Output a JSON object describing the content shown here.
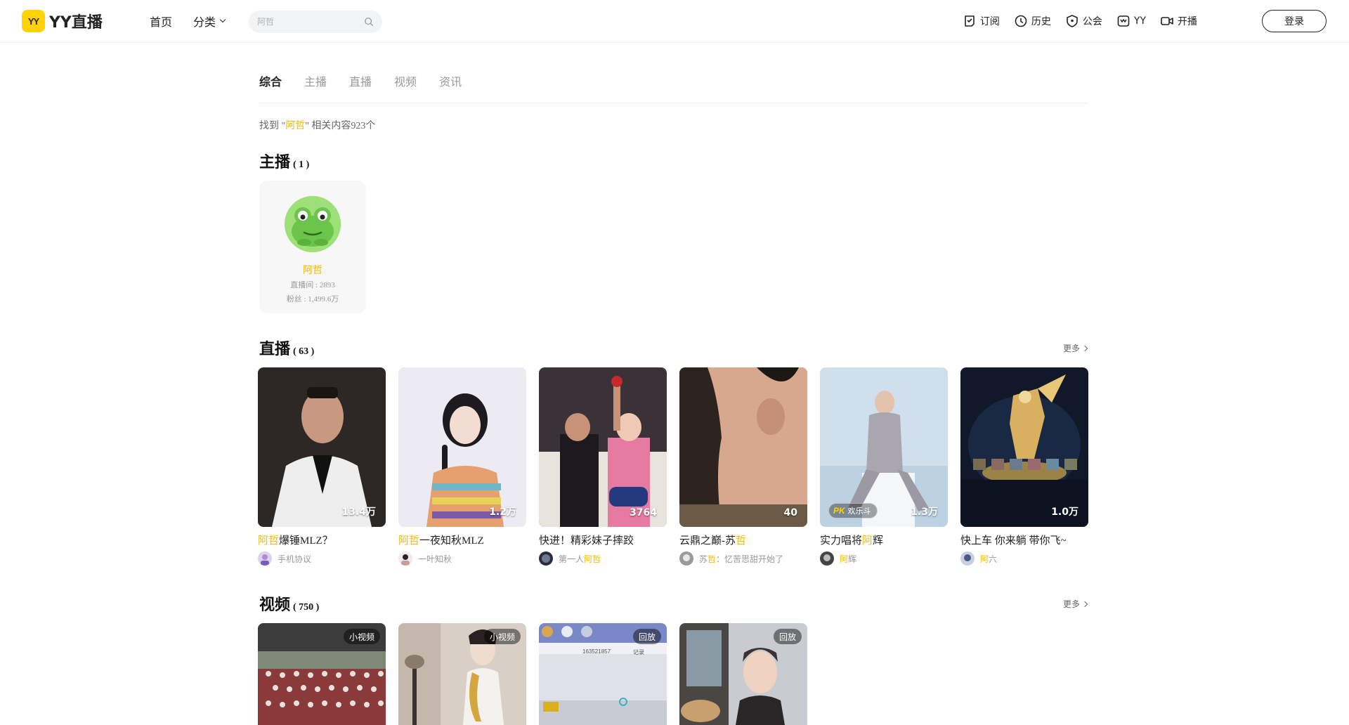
{
  "header": {
    "logo_badge": "YY",
    "logo_text": "YY直播",
    "nav": {
      "home": "首页",
      "category": "分类"
    },
    "search": {
      "placeholder": "阿哲"
    },
    "right_nav": {
      "subscribe": "订阅",
      "history": "历史",
      "guild": "公会",
      "yy": "YY",
      "broadcast": "开播"
    },
    "login": "登录"
  },
  "tabs": [
    {
      "label": "综合",
      "active": true
    },
    {
      "label": "主播",
      "active": false
    },
    {
      "label": "直播",
      "active": false
    },
    {
      "label": "视频",
      "active": false
    },
    {
      "label": "资讯",
      "active": false
    }
  ],
  "result": {
    "prefix": "找到 \"",
    "keyword": "阿哲",
    "suffix": "\" 相关内容923个"
  },
  "anchors_section": {
    "title": "主播",
    "count": "( 1 )"
  },
  "anchor": {
    "name": "阿哲",
    "room": "直播间 : 2893",
    "fans": "粉丝 : 1,499.6万"
  },
  "live_section": {
    "title": "直播",
    "count": "( 63 )",
    "more": "更多"
  },
  "live_items": [
    {
      "title_hl": "阿哲",
      "title_rest": "爆锤MLZ？",
      "viewers": "13.4万",
      "anchor_pre": "",
      "anchor_hl": "",
      "anchor_post": "手机协议",
      "badge": ""
    },
    {
      "title_hl": "阿哲",
      "title_rest": "一夜知秋MLZ",
      "viewers": "1.2万",
      "anchor_pre": "",
      "anchor_hl": "",
      "anchor_post": "一叶知秋",
      "badge": ""
    },
    {
      "title_pre": "快进！精彩妹子摔跤",
      "title_hl": "",
      "title_rest": "",
      "viewers": "3764",
      "anchor_pre": "第一人",
      "anchor_hl": "阿哲",
      "anchor_post": "",
      "badge": ""
    },
    {
      "title_pre": "云鼎之巅-苏",
      "title_hl": "哲",
      "title_rest": "",
      "viewers": "40",
      "anchor_pre": "苏",
      "anchor_hl": "哲",
      "anchor_post": "：忆苦思甜开始了",
      "badge": ""
    },
    {
      "title_pre": "实力唱将",
      "title_hl": "阿",
      "title_rest": "辉",
      "viewers": "1.3万",
      "anchor_pre": "",
      "anchor_hl": "阿",
      "anchor_post": "辉",
      "badge": "欢乐斗",
      "badge_pk": "PK"
    },
    {
      "title_pre": "快上车 你来躺 带你飞~",
      "title_hl": "",
      "title_rest": "",
      "viewers": "1.0万",
      "anchor_pre": "",
      "anchor_hl": "阿",
      "anchor_post": "六",
      "badge": ""
    }
  ],
  "video_section": {
    "title": "视频",
    "count": "( 750 )",
    "more": "更多"
  },
  "video_items": [
    {
      "tag": "小视频"
    },
    {
      "tag": "小视频"
    },
    {
      "tag": "回放",
      "overlay_id": "163521857",
      "overlay_note": "记录"
    },
    {
      "tag": "回放"
    }
  ],
  "colors": {
    "brand_yellow": "#ffd200",
    "highlight": "#f5b800"
  }
}
